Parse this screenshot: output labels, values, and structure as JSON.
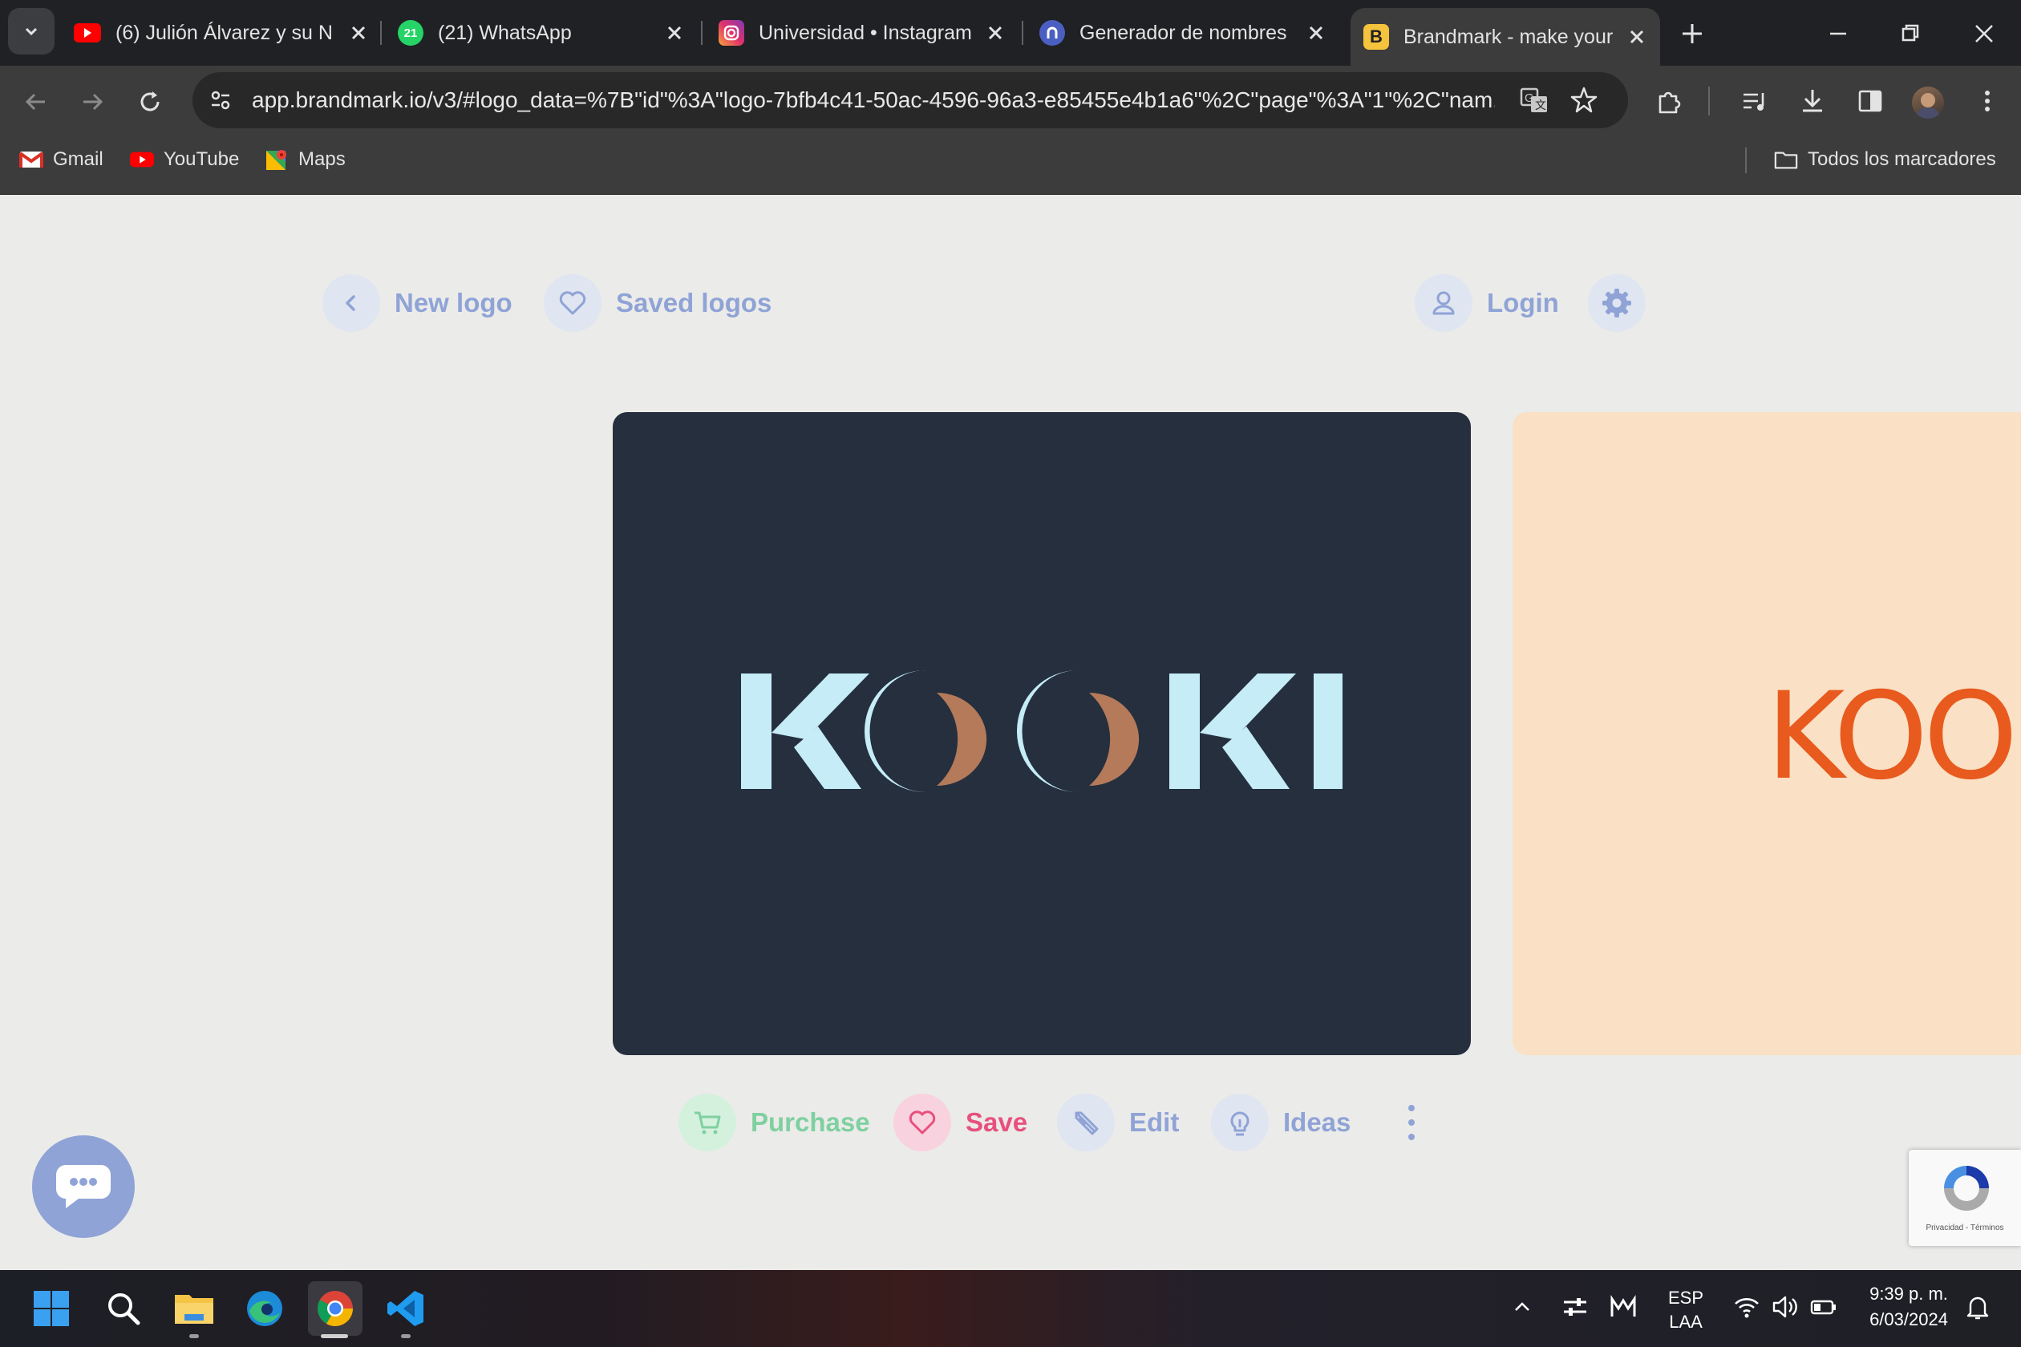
{
  "browser": {
    "tabs": [
      {
        "title": "(6) Julión Álvarez y su N",
        "icon": "youtube-icon"
      },
      {
        "title": "(21) WhatsApp",
        "icon": "whatsapp-icon",
        "badge": "21"
      },
      {
        "title": "Universidad • Instagram",
        "icon": "instagram-icon"
      },
      {
        "title": "Generador de nombres",
        "icon": "namelix-icon"
      },
      {
        "title": "Brandmark - make your",
        "icon": "brandmark-icon",
        "letter": "B"
      }
    ],
    "address": "app.brandmark.io/v3/#logo_data=%7B\"id\"%3A\"logo-7bfb4c41-50ac-4596-96a3-e85455e4b1a6\"%2C\"page\"%3A\"1\"%2C\"nam...",
    "bookmarks": [
      {
        "label": "Gmail",
        "icon": "gmail-icon"
      },
      {
        "label": "YouTube",
        "icon": "youtube-icon"
      },
      {
        "label": "Maps",
        "icon": "maps-icon"
      }
    ],
    "all_bookmarks": "Todos los marcadores"
  },
  "page": {
    "nav": {
      "new_logo": "New logo",
      "saved_logos": "Saved logos",
      "login": "Login"
    },
    "logo_text": "KOOKI",
    "logo_preview_text": "KOO",
    "actions": {
      "purchase": "Purchase",
      "save": "Save",
      "edit": "Edit",
      "ideas": "Ideas"
    },
    "recaptcha": "Privacidad - Términos"
  },
  "colors": {
    "accent": "#8fa3d6",
    "card_bg": "#252f3e",
    "logo_light": "#c5ecf7",
    "logo_copper": "#b47a5a",
    "preview_bg": "#fae0c4",
    "preview_text": "#e85a1e",
    "purchase_green": "#7fd0a0",
    "save_pink": "#e8507e"
  },
  "taskbar": {
    "lang": "ESP",
    "layout": "LAA",
    "time": "9:39 p. m.",
    "date": "6/03/2024"
  }
}
